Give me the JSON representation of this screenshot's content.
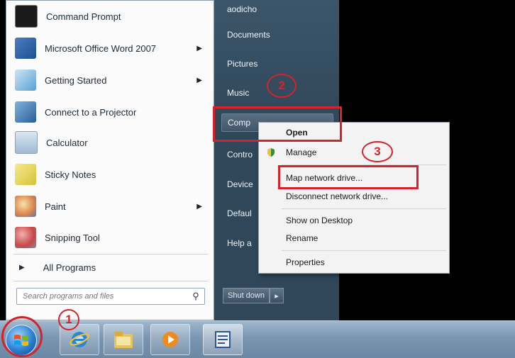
{
  "start_menu": {
    "programs": [
      {
        "label": "Command Prompt",
        "icon": "command-prompt-icon",
        "color": "#1a1a1a",
        "has_arrow": false
      },
      {
        "label": "Microsoft Office Word 2007",
        "icon": "word-icon",
        "color": "#2b579a",
        "has_arrow": true
      },
      {
        "label": "Getting Started",
        "icon": "getting-started-icon",
        "color": "#5aa0d6",
        "has_arrow": true
      },
      {
        "label": "Connect to a Projector",
        "icon": "projector-icon",
        "color": "#3a7fc0",
        "has_arrow": false
      },
      {
        "label": "Calculator",
        "icon": "calculator-icon",
        "color": "#a9c3dc",
        "has_arrow": false
      },
      {
        "label": "Sticky Notes",
        "icon": "sticky-notes-icon",
        "color": "#e6d34a",
        "has_arrow": false
      },
      {
        "label": "Paint",
        "icon": "paint-icon",
        "color": "#d9844a",
        "has_arrow": true
      },
      {
        "label": "Snipping Tool",
        "icon": "snipping-tool-icon",
        "color": "#c84646",
        "has_arrow": false
      }
    ],
    "all_programs": "All Programs",
    "search_placeholder": "Search programs and files"
  },
  "right_pane": {
    "items": [
      {
        "label": "aodicho"
      },
      {
        "label": "Documents"
      },
      {
        "label": "Pictures"
      },
      {
        "label": "Music"
      },
      {
        "label": "Comp"
      },
      {
        "label": "Contro"
      },
      {
        "label": "Device"
      },
      {
        "label": "Defaul"
      },
      {
        "label": "Help a"
      }
    ],
    "shutdown_label": "Shut down"
  },
  "context_menu": {
    "items": [
      {
        "label": "Open"
      },
      {
        "label": "Manage"
      },
      {
        "label": "Map network drive..."
      },
      {
        "label": "Disconnect network drive..."
      },
      {
        "label": "Show on Desktop"
      },
      {
        "label": "Rename"
      },
      {
        "label": "Properties"
      }
    ]
  },
  "annotations": {
    "step1": "1",
    "step2": "2",
    "step3": "3"
  },
  "colors": {
    "accent": "#d6222a"
  }
}
